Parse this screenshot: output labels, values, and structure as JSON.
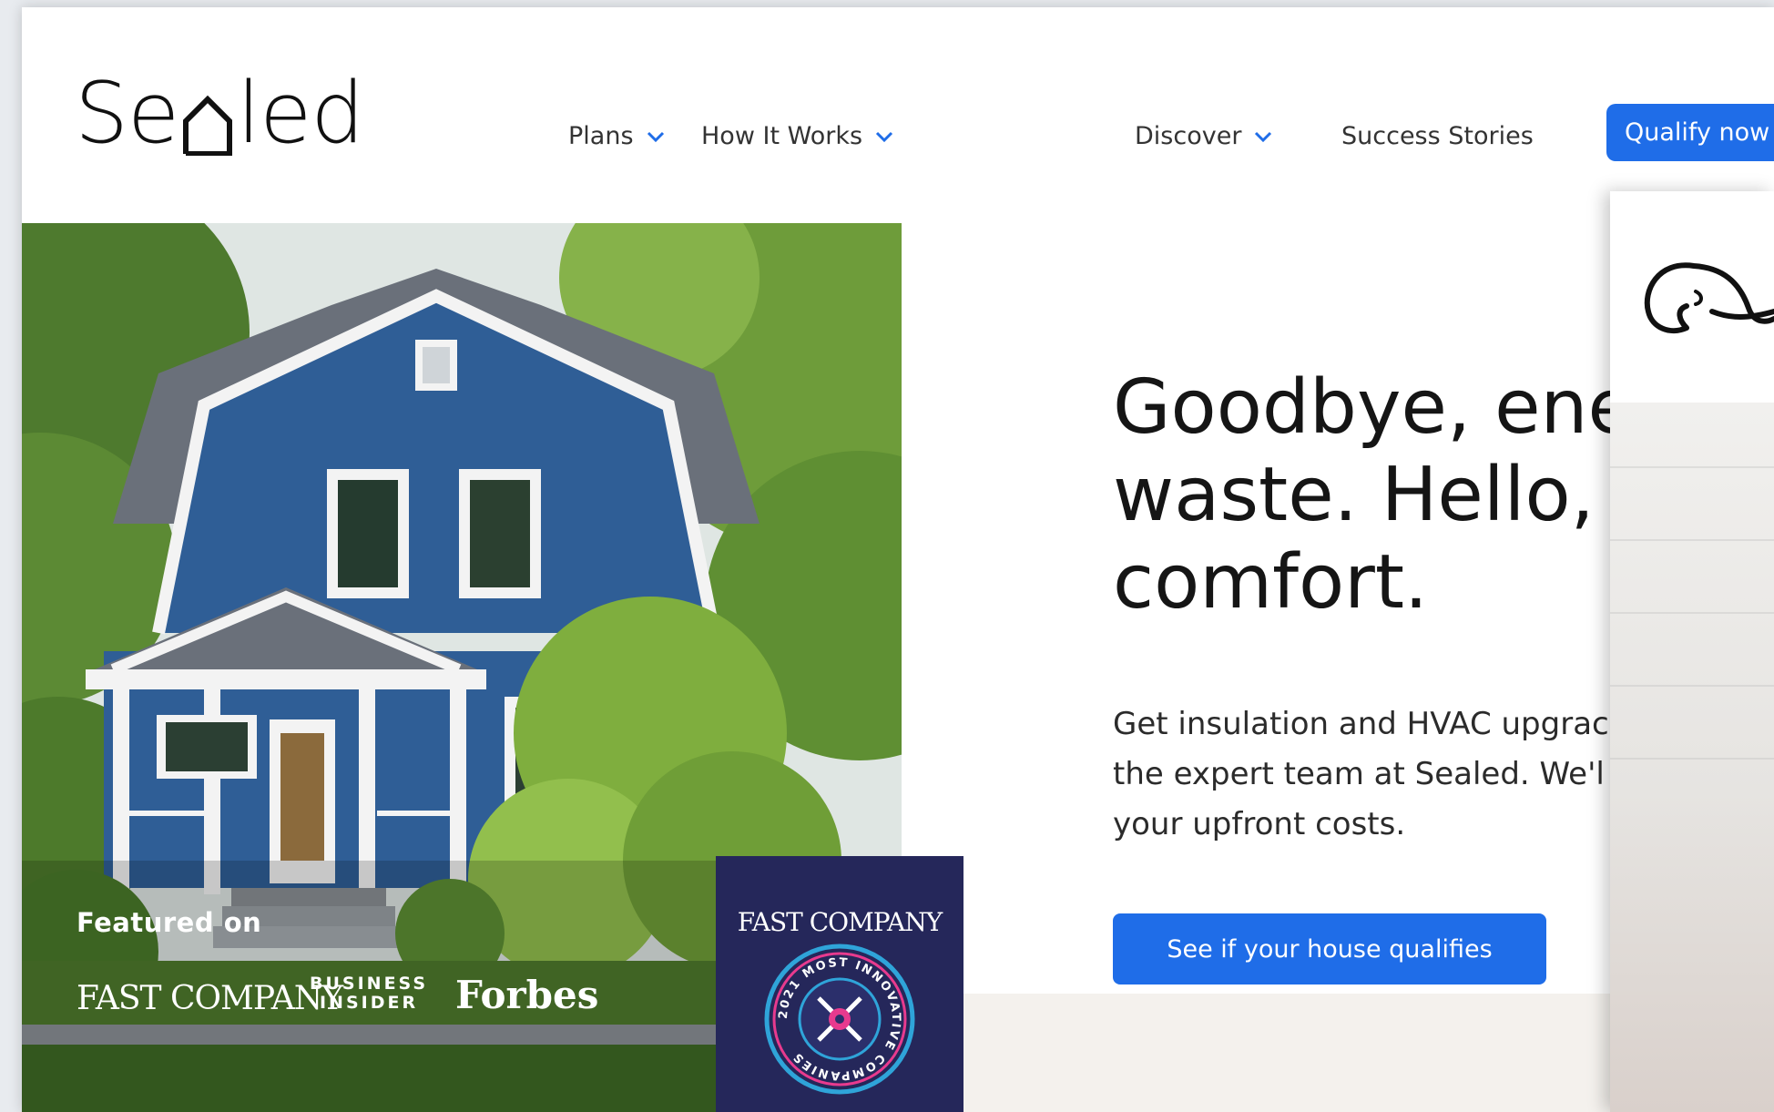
{
  "header": {
    "logo_text_pre": "Se",
    "logo_text_post": "led",
    "nav": [
      {
        "label": "Plans",
        "has_dropdown": true
      },
      {
        "label": "How It Works",
        "has_dropdown": true
      },
      {
        "label": "Discover",
        "has_dropdown": true
      },
      {
        "label": "Success Stories",
        "has_dropdown": false
      }
    ],
    "qualify_label": "Qualify now"
  },
  "hero": {
    "featured_label": "Featured on",
    "press": {
      "fastcompany": "FAST COMPANY",
      "business_insider_line1": "BUSINESS",
      "business_insider_line2": "INSIDER",
      "forbes": "Forbes"
    },
    "award": {
      "title": "FAST COMPANY",
      "ring_text": "2021 MOST INNOVATIVE COMPANIES"
    },
    "headline": "Goodbye, ener\nwaste. Hello,\ncomfort.",
    "subcopy": "Get insulation and HVAC upgrac\nthe expert team at Sealed. We'l\nyour upfront costs.",
    "cta_label": "See if your house qualifies"
  },
  "colors": {
    "accent_blue": "#1f6de8",
    "award_navy": "#25275a",
    "band_beige": "#f4f1ed"
  }
}
